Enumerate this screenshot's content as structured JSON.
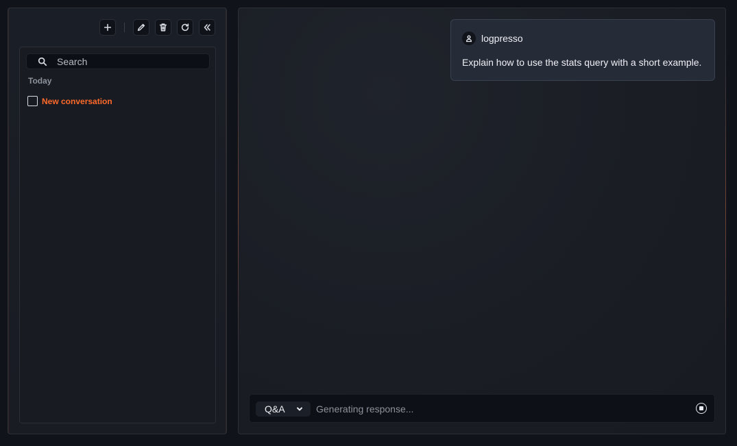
{
  "sidebar": {
    "toolbar": {
      "new_icon": "plus-icon",
      "edit_icon": "pencil-icon",
      "delete_icon": "trash-icon",
      "refresh_icon": "refresh-icon",
      "collapse_icon": "double-chevron-left-icon"
    },
    "search": {
      "placeholder": "Search",
      "icon": "search-icon"
    },
    "groups": [
      {
        "label": "Today",
        "items": [
          {
            "title": "New conversation",
            "checked": false
          }
        ]
      }
    ],
    "accent_color": "#ff6a2a"
  },
  "chat": {
    "messages": [
      {
        "role": "user",
        "author": "logpresso",
        "text": "Explain how to use the stats query with a short example."
      }
    ]
  },
  "composer": {
    "mode": "Q&A",
    "placeholder": "Generating response...",
    "value": "",
    "stop_icon": "stop-icon"
  }
}
